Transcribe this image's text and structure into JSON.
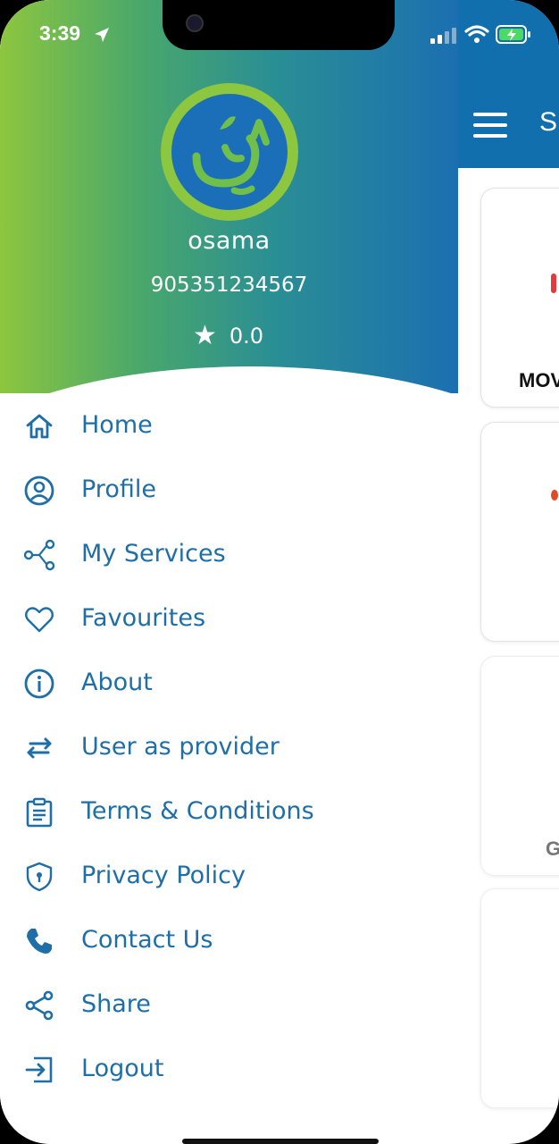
{
  "status_bar": {
    "time": "3:39"
  },
  "background_app": {
    "title": "S",
    "cards": [
      {
        "label": "MOV"
      },
      {
        "label": ""
      },
      {
        "label": "G"
      },
      {
        "label": ""
      }
    ]
  },
  "drawer": {
    "user": {
      "name": "osama",
      "phone": "905351234567",
      "rating": "0.0"
    },
    "menu": [
      {
        "label": "Home",
        "icon": "home-icon"
      },
      {
        "label": "Profile",
        "icon": "profile-icon"
      },
      {
        "label": "My Services",
        "icon": "services-icon"
      },
      {
        "label": "Favourites",
        "icon": "heart-icon"
      },
      {
        "label": "About",
        "icon": "info-icon"
      },
      {
        "label": "User as provider",
        "icon": "swap-icon"
      },
      {
        "label": "Terms & Conditions",
        "icon": "clipboard-icon"
      },
      {
        "label": "Privacy Policy",
        "icon": "shield-icon"
      },
      {
        "label": "Contact Us",
        "icon": "phone-icon"
      },
      {
        "label": "Share",
        "icon": "share-icon"
      },
      {
        "label": "Logout",
        "icon": "logout-icon"
      }
    ]
  },
  "colors": {
    "accent_green": "#8dc63f",
    "accent_blue": "#1b6fb1",
    "menu_text": "#1e6ea8"
  }
}
